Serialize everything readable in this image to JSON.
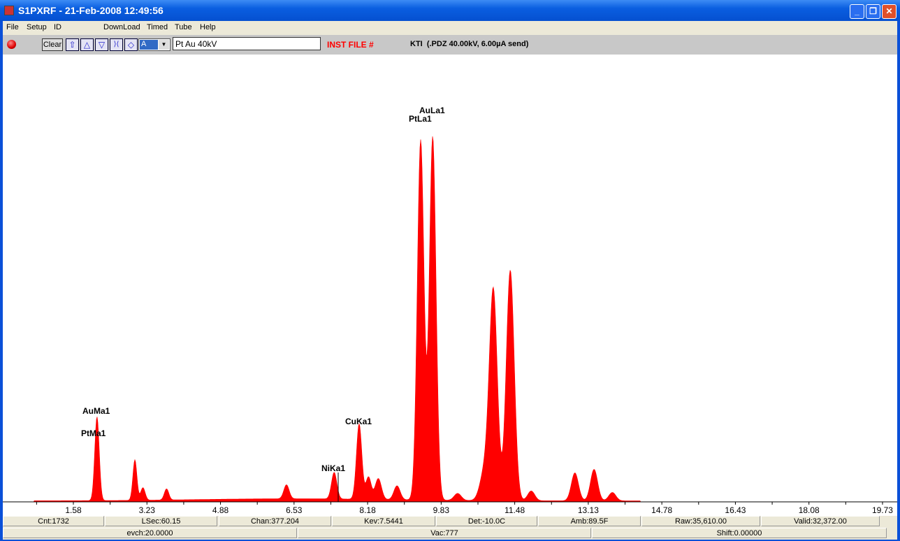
{
  "window": {
    "title": "S1PXRF - 21-Feb-2008 12:49:56",
    "buttons": {
      "minimize": "_",
      "maximize": "❐",
      "close": "✕"
    }
  },
  "menu": [
    "File",
    "Setup",
    "ID",
    "DownLoad",
    "Timed",
    "Tube",
    "Help"
  ],
  "toolbar": {
    "clear_label": "Clear",
    "icons": [
      "home-up-icon",
      "arrow-up-icon",
      "arrow-down-icon",
      "expand-icon",
      "contract-icon"
    ],
    "icon_glyphs": [
      "⇧",
      "△",
      "▽",
      "⟩⟨",
      "◇"
    ],
    "select_value": "A",
    "sample_name": "Pt Au 40kV",
    "inst_file": "INST FILE #",
    "inst_info": "KTI  (.PDZ 40.00kV, 6.00µA send)",
    "inst_file_color": "#ff0000"
  },
  "chart_data": {
    "type": "area",
    "color": "#ff0000",
    "xlabel": "",
    "ylabel": "",
    "xlim": [
      0,
      20
    ],
    "x_ticks": [
      "1.58",
      "3.23",
      "4.88",
      "6.53",
      "8.18",
      "9.83",
      "11.48",
      "13.13",
      "14.78",
      "16.43",
      "18.08",
      "19.73"
    ],
    "peaks_keV_relheight_sigma": [
      [
        2.11,
        120,
        0.05
      ],
      [
        2.96,
        58,
        0.045
      ],
      [
        3.14,
        18,
        0.05
      ],
      [
        3.67,
        16,
        0.05
      ],
      [
        6.36,
        20,
        0.06
      ],
      [
        7.43,
        38,
        0.06
      ],
      [
        7.99,
        108,
        0.06
      ],
      [
        8.2,
        32,
        0.06
      ],
      [
        8.42,
        30,
        0.07
      ],
      [
        8.84,
        20,
        0.07
      ],
      [
        9.37,
        515,
        0.075
      ],
      [
        9.64,
        520,
        0.075
      ],
      [
        10.2,
        10,
        0.08
      ],
      [
        10.8,
        40,
        0.1
      ],
      [
        11.0,
        300,
        0.09
      ],
      [
        11.38,
        330,
        0.09
      ],
      [
        11.85,
        14,
        0.08
      ],
      [
        12.83,
        40,
        0.08
      ],
      [
        13.26,
        45,
        0.08
      ],
      [
        13.67,
        12,
        0.08
      ]
    ],
    "annotations": [
      {
        "label": "AuMa1",
        "keV": 2.11
      },
      {
        "label": "PtMa1",
        "keV": 2.11
      },
      {
        "label": "NiKa1",
        "keV": 7.5
      },
      {
        "label": "CuKa1",
        "keV": 7.99
      },
      {
        "label": "PtLa1",
        "keV": 9.37
      },
      {
        "label": "AuLa1",
        "keV": 9.64
      }
    ]
  },
  "status": {
    "row1": [
      "Cnt:1732",
      "LSec:60.15",
      "Chan:377.204",
      "Kev:7.5441",
      "Det:-10.0C",
      "Amb:89.5F",
      "Raw:35,610.00",
      "Valid:32,372.00"
    ],
    "row2": [
      "evch:20.0000",
      "Vac:777",
      "Shift:0.00000"
    ]
  }
}
